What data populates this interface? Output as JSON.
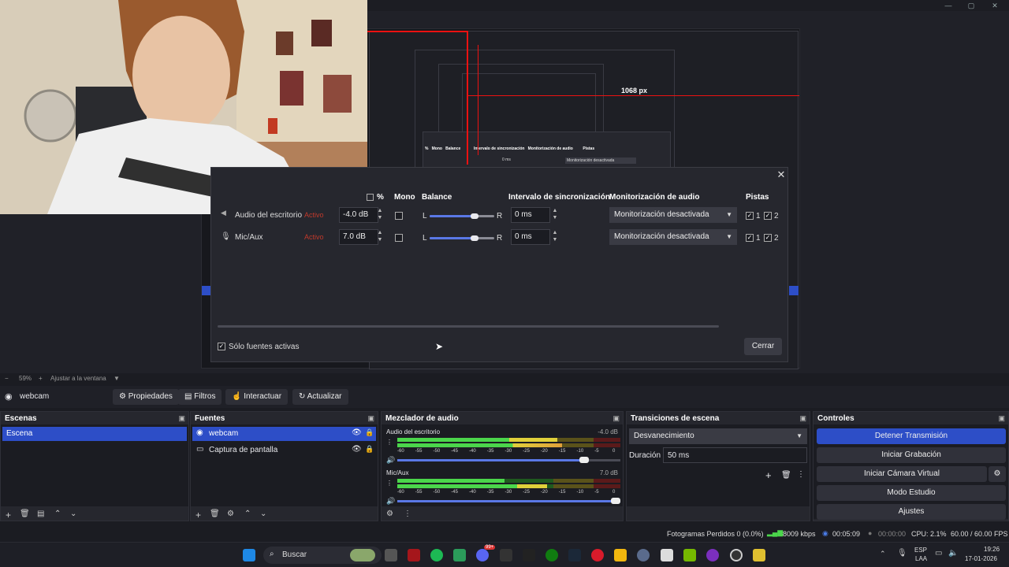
{
  "window": {
    "controls": [
      "—",
      "▢",
      "✕"
    ]
  },
  "preview": {
    "measure_label": "1068 px",
    "nested_headers": [
      "%",
      "Mono",
      "Balance",
      "Intervalo de sincronización",
      "Monitorización de audio",
      "Pistas"
    ],
    "nested_row": {
      "ms": "0 ms",
      "monitor": "Monitorización desactivada"
    }
  },
  "dialog": {
    "headers": {
      "percent": "%",
      "mono": "Mono",
      "balance": "Balance",
      "sync": "Intervalo de sincronización",
      "monitoring": "Monitorización de audio",
      "tracks": "Pistas"
    },
    "rows": [
      {
        "name": "Audio del escritorio",
        "status": "Activo",
        "volume": "-4.0 dB",
        "balance_fraction": 0.7,
        "sync": "0 ms",
        "monitoring": "Monitorización desactivada",
        "track1": "1",
        "track2": "2"
      },
      {
        "name": "Mic/Aux",
        "status": "Activo",
        "volume": "7.0 dB",
        "balance_fraction": 0.7,
        "sync": "0 ms",
        "monitoring": "Monitorización desactivada",
        "track1": "1",
        "track2": "2"
      }
    ],
    "balance_left": "L",
    "balance_right": "R",
    "only_active": "Sólo fuentes activas",
    "close": "Cerrar"
  },
  "zoom": {
    "value": "59%",
    "fit": "Ajustar a la ventana"
  },
  "source_toolbar": {
    "source": "webcam",
    "properties": "Propiedades",
    "filters": "Filtros",
    "interact": "Interactuar",
    "refresh": "Actualizar"
  },
  "scenes": {
    "title": "Escenas",
    "items": [
      "Escena"
    ]
  },
  "sources": {
    "title": "Fuentes",
    "items": [
      "webcam",
      "Captura de pantalla"
    ]
  },
  "mixer": {
    "title": "Mezclador de audio",
    "channels": [
      {
        "name": "Audio del escritorio",
        "db": "-4.0 dB",
        "level": 0.86
      },
      {
        "name": "Mic/Aux",
        "db": "7.0 dB",
        "level": 1.0
      }
    ],
    "scale": [
      "-60",
      "-55",
      "-50",
      "-45",
      "-40",
      "-35",
      "-30",
      "-25",
      "-20",
      "-15",
      "-10",
      "-5",
      "0"
    ]
  },
  "transitions": {
    "title": "Transiciones de escena",
    "selected": "Desvanecimiento",
    "duration_label": "Duración",
    "duration_value": "50 ms"
  },
  "controls": {
    "title": "Controles",
    "stop_stream": "Detener Transmisión",
    "start_record": "Iniciar Grabación",
    "virtual_cam": "Iniciar Cámara Virtual",
    "studio_mode": "Modo Estudio",
    "settings": "Ajustes"
  },
  "status": {
    "dropped": "Fotogramas Perdidos 0 (0.0%)",
    "bitrate": "8009 kbps",
    "stream_time": "00:05:09",
    "record_time": "00:00:00",
    "cpu": "CPU: 2.1%",
    "fps": "60.00 / 60.00 FPS"
  },
  "taskbar": {
    "search": "Buscar",
    "lang1": "ESP",
    "lang2": "LAA",
    "time": "19:26",
    "date": "17-01-2026",
    "badge": "99+"
  }
}
